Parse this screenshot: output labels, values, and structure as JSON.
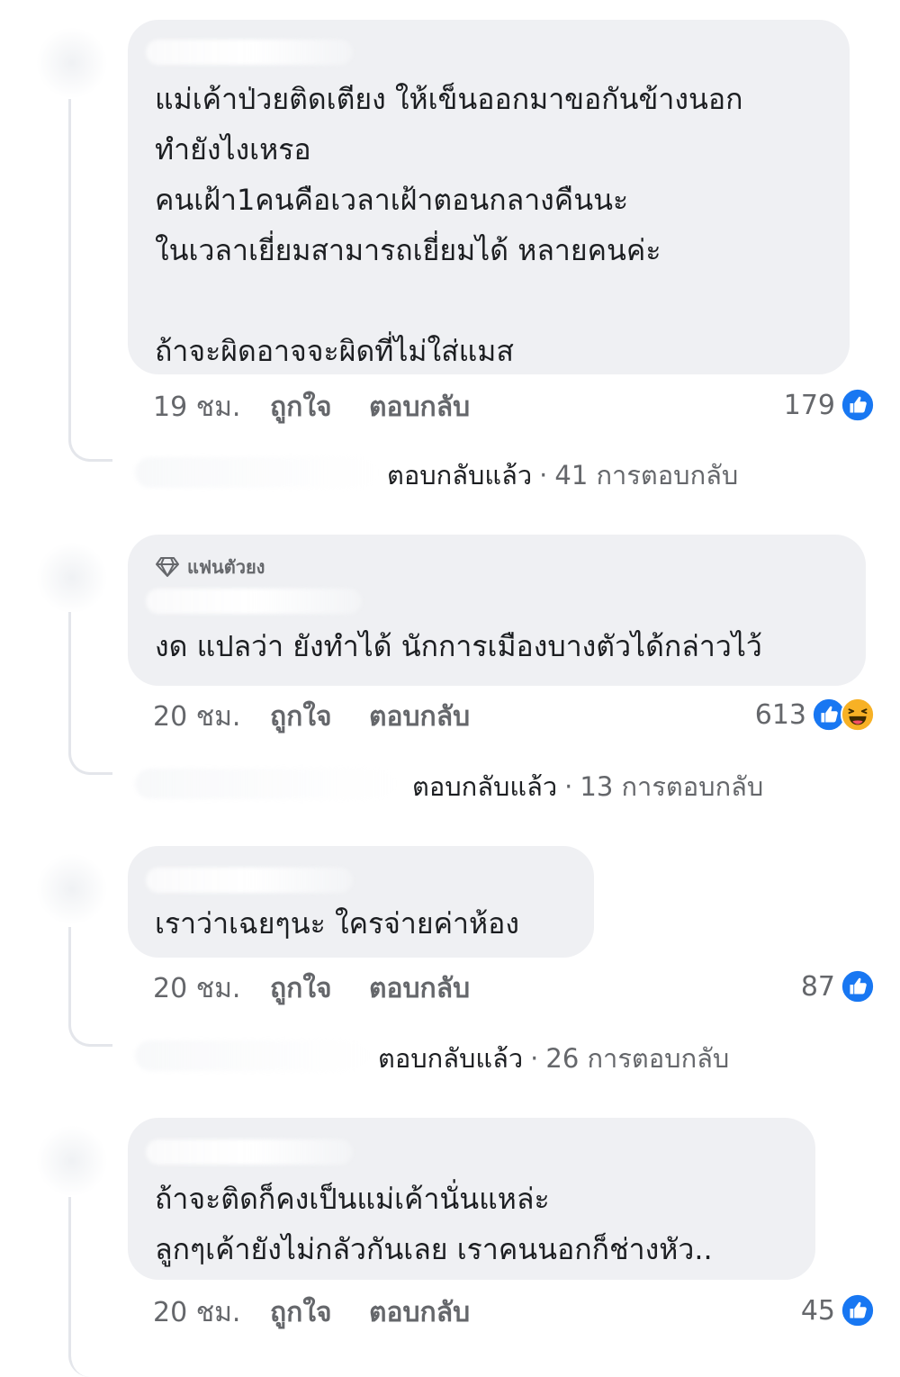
{
  "comments": [
    {
      "badge": "",
      "text": "แม่เค้าป่วยติดเตียง ให้เข็นออกมาขอกันข้างนอก\nทำยังไงเหรอ\nคนเฝ้า1คนคือเวลาเฝ้าตอนกลางคืนนะ\nในเวลาเยี่ยมสามารถเยี่ยมได้ หลายคนค่ะ\n\nถ้าจะผิดอาจจะผิดที่ไม่ใส่แมส",
      "time": "19 ชม.",
      "like_label": "ถูกใจ",
      "reply_label": "ตอบกลับ",
      "reaction_count": "179",
      "reactions": [
        "like-icon"
      ],
      "replies_status": "ตอบกลับแล้ว",
      "replies_count": "41 การตอบกลับ"
    },
    {
      "badge": "แฟนตัวยง",
      "badge_icon": "diamond-icon",
      "text": "งด แปลว่า ยังทำได้ นักการเมืองบางตัวได้กล่าวไว้",
      "time": "20 ชม.",
      "like_label": "ถูกใจ",
      "reply_label": "ตอบกลับ",
      "reaction_count": "613",
      "reactions": [
        "like-icon",
        "haha-icon"
      ],
      "replies_status": "ตอบกลับแล้ว",
      "replies_count": "13 การตอบกลับ"
    },
    {
      "badge": "",
      "text": "เราว่าเฉยๆนะ ใครจ่ายค่าห้อง",
      "time": "20 ชม.",
      "like_label": "ถูกใจ",
      "reply_label": "ตอบกลับ",
      "reaction_count": "87",
      "reactions": [
        "like-icon"
      ],
      "replies_status": "ตอบกลับแล้ว",
      "replies_count": "26 การตอบกลับ"
    },
    {
      "badge": "",
      "text": "ถ้าจะติดก็คงเป็นแม่เค้านั่นแหล่ะ\nลูกๆเค้ายังไม่กลัวกันเลย เราคนนอกก็ช่างหัว..",
      "time": "20 ชม.",
      "like_label": "ถูกใจ",
      "reply_label": "ตอบกลับ",
      "reaction_count": "45",
      "reactions": [
        "like-icon"
      ]
    }
  ],
  "colors": {
    "bubble": "#eff0f3",
    "meta_text": "#65676b",
    "like_blue": "#1877f2",
    "haha_yellow": "#f7b125"
  }
}
